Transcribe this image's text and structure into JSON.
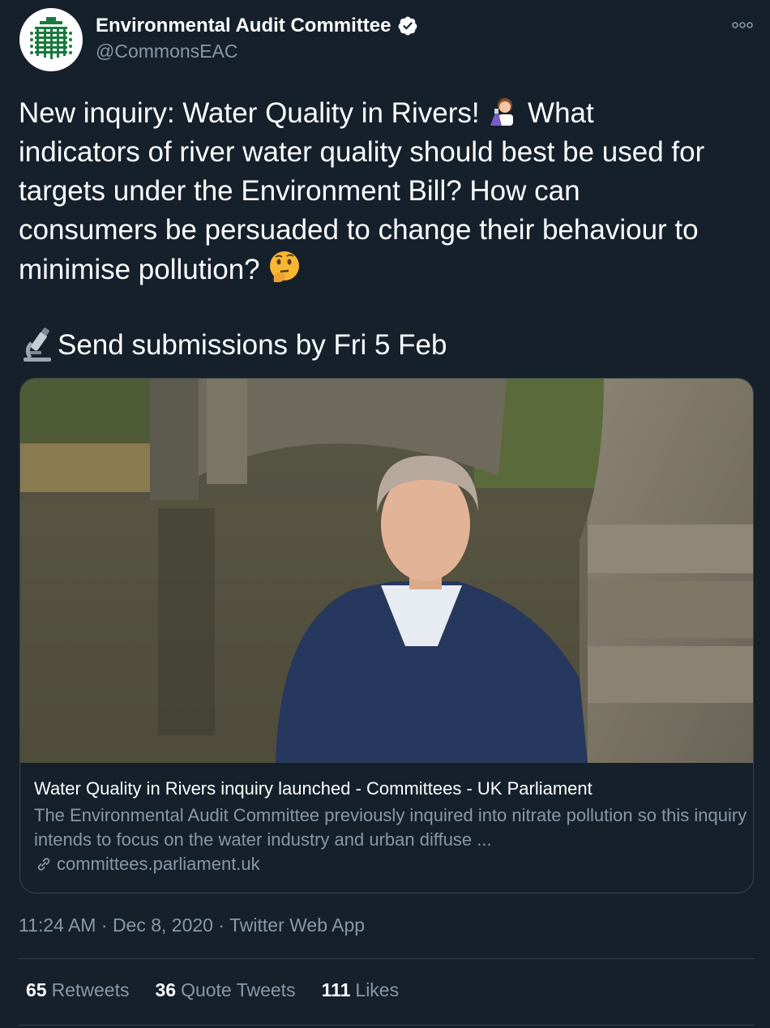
{
  "account": {
    "name": "Environmental Audit Committee",
    "handle": "@CommonsEAC",
    "verified": true,
    "avatar_icon": "portcullis-logo-icon"
  },
  "tweet": {
    "text_line1a": "New inquiry: Water Quality in Rivers! ",
    "text_line1b": " What",
    "text_rest": "indicators of river water quality should best be used for\ntargets under the Environment Bill? How can\nconsumers be persuaded to change their behaviour to\nminimise pollution? ",
    "submit_text": "Send submissions by Fri 5 Feb",
    "emoji_scientist": "woman-scientist-emoji",
    "emoji_thinking": "thinking-face-emoji",
    "emoji_microscope": "microscope-emoji"
  },
  "card": {
    "image_desc": "photo-man-by-river-bridge",
    "title": "Water Quality in Rivers inquiry launched - Committees - UK Parliament",
    "description": "The Environmental Audit Committee previously inquired into nitrate pollution so this inquiry intends to focus on the water industry and urban diffuse ...",
    "domain": "committees.parliament.uk"
  },
  "meta": {
    "time": "11:24 AM",
    "date": "Dec 8, 2020",
    "app": "Twitter Web App",
    "sep": " · "
  },
  "stats": {
    "retweets_count": "65",
    "retweets_label": "Retweets",
    "quotes_count": "36",
    "quotes_label": "Quote Tweets",
    "likes_count": "111",
    "likes_label": "Likes"
  },
  "colors": {
    "background": "#15202b",
    "secondary_text": "#8899a6",
    "border": "#38444d"
  }
}
